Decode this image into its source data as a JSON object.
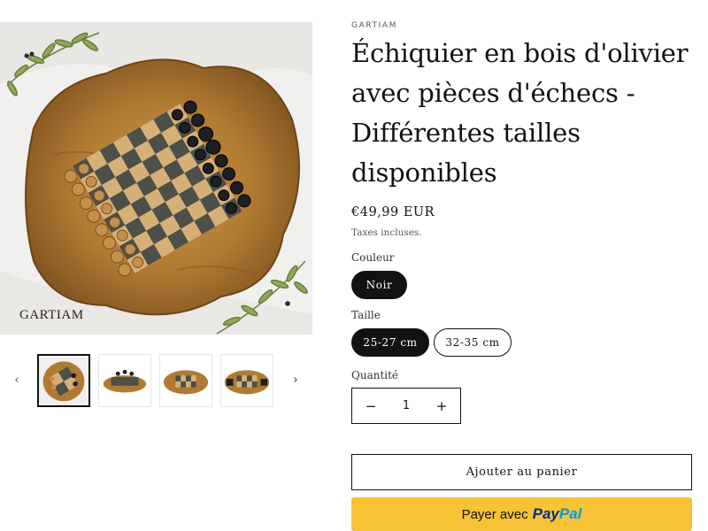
{
  "gallery": {
    "brand_mark": "GARTIAM",
    "main_image": "olive-wood-chessboard-with-pieces",
    "thumbnails": [
      "chessboard-top-view",
      "chessboard-side-view",
      "chessboard-with-drawers",
      "chessboard-open-drawers"
    ],
    "prev_icon": "chevron-left-icon",
    "next_icon": "chevron-right-icon"
  },
  "product": {
    "vendor": "GARTIAM",
    "title_lines": [
      "Échiquier en bois d'olivier",
      "avec pièces d'échecs -",
      "Différentes tailles",
      "disponibles"
    ],
    "price": "€49,99 EUR",
    "tax_note": "Taxes incluses."
  },
  "options": {
    "color_label": "Couleur",
    "colors": [
      "Noir"
    ],
    "selected_color": "Noir",
    "size_label": "Taille",
    "sizes": [
      "25-27 cm",
      "32-35 cm"
    ],
    "selected_size": "25-27 cm"
  },
  "quantity": {
    "label": "Quantité",
    "value": "1",
    "minus_icon": "minus-icon",
    "plus_icon": "plus-icon"
  },
  "buttons": {
    "add_to_cart": "Ajouter au panier",
    "paypal_prefix": "Payer avec",
    "paypal_brand_a": "Pay",
    "paypal_brand_b": "Pal"
  },
  "colors": {
    "primary": "#121212",
    "paypal_yellow": "#f8c236",
    "paypal_dark_blue": "#003087",
    "paypal_light_blue": "#009cde"
  }
}
